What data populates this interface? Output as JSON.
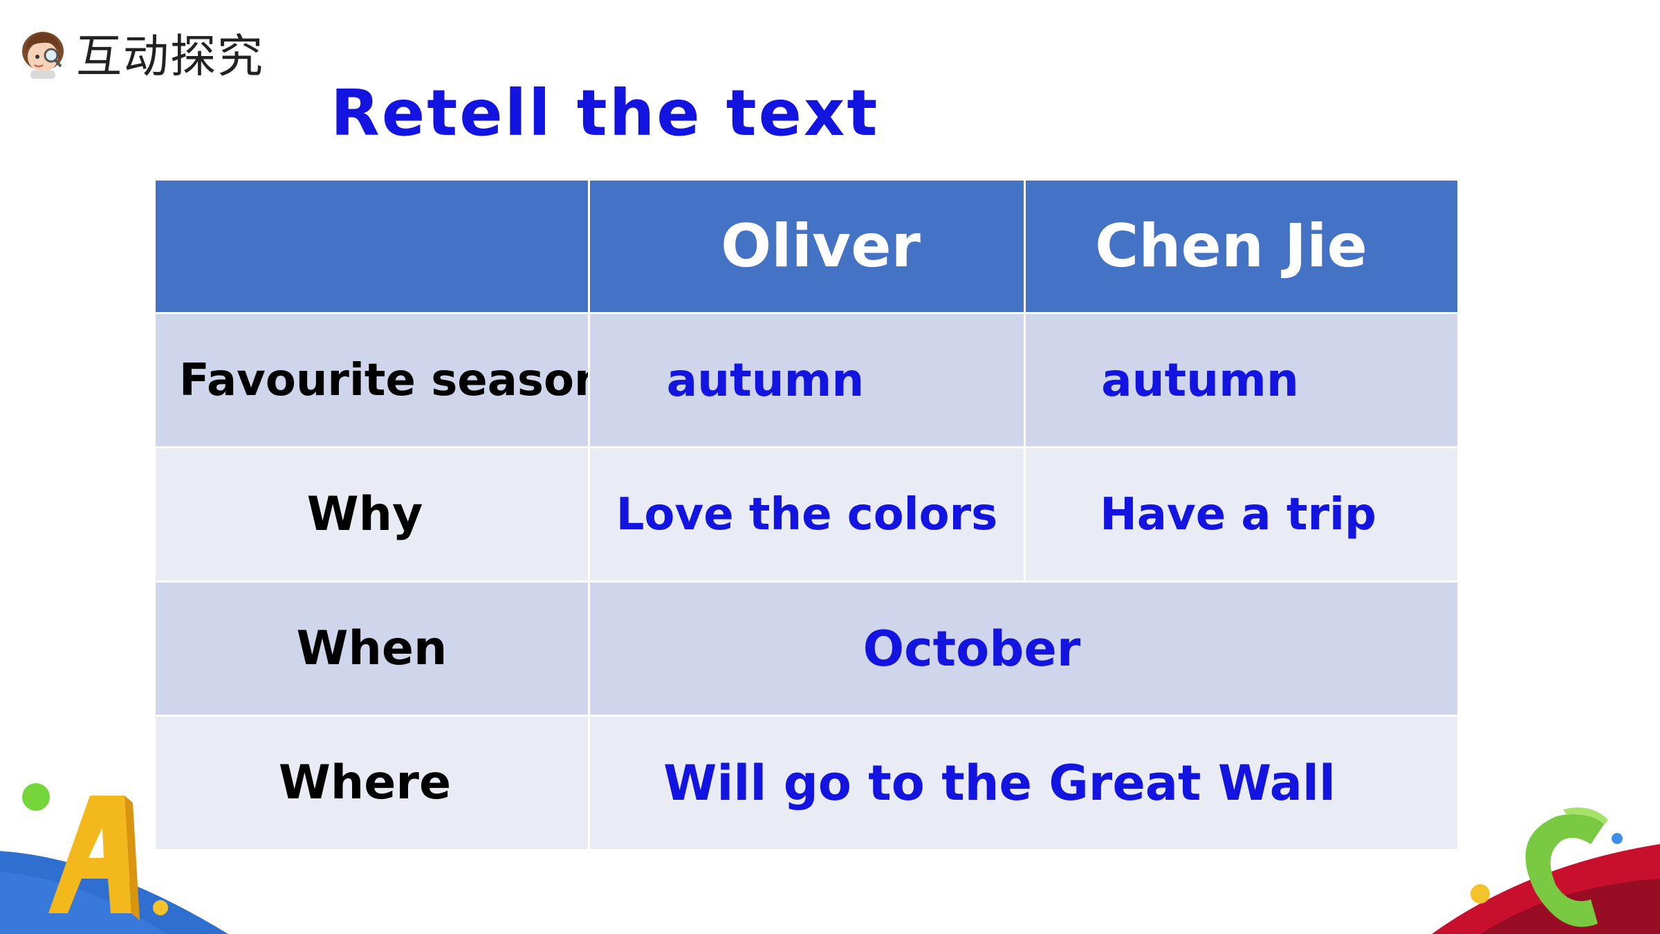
{
  "header": {
    "section_title": "互动探究",
    "avatar_icon": "girl-with-magnifier-icon"
  },
  "slide": {
    "title": "Retell the text"
  },
  "table": {
    "columns": [
      "",
      "Oliver",
      "Chen Jie"
    ],
    "rows": [
      {
        "label": "Favourite season",
        "values": [
          "autumn",
          "autumn"
        ]
      },
      {
        "label": "Why",
        "values": [
          "Love the colors",
          "Have a trip"
        ]
      },
      {
        "label": "When",
        "values": [
          "October"
        ]
      },
      {
        "label": "Where",
        "values": [
          "Will go to the Great Wall"
        ]
      }
    ]
  },
  "colors": {
    "header_fill": "#4472c4",
    "band_dark": "#cfd5ea",
    "band_light": "#e9ebf5",
    "answer_text": "#1414e0"
  }
}
